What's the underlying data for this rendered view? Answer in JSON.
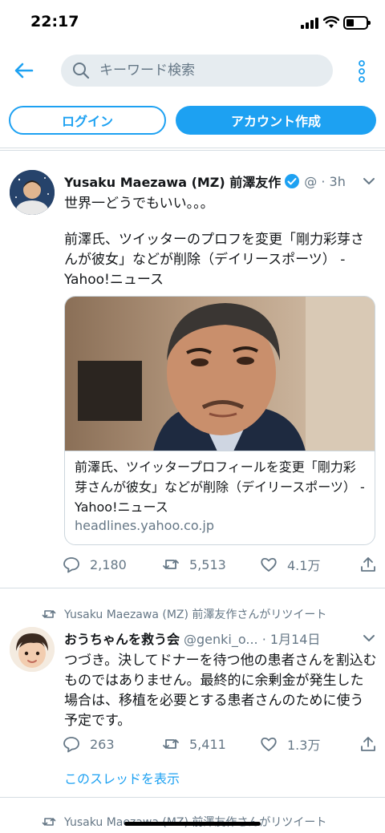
{
  "status_bar": {
    "time": "22:17"
  },
  "nav": {
    "search_placeholder": "キーワード検索",
    "back_icon": "arrow-left-icon",
    "more_icon": "vertical-dots-icon"
  },
  "auth": {
    "login_label": "ログイン",
    "signup_label": "アカウント作成"
  },
  "tweet1": {
    "author_name": "Yusaku Maezawa (MZ) 前澤友作",
    "handle_time": "@ · 3h",
    "text_line1": "世界一どうでもいい。。。",
    "text_line2": "前澤氏、ツイッターのプロフを変更「剛力彩芽さんが彼女」などが削除（デイリースポーツ） - Yahoo!ニュース",
    "card": {
      "title": "前澤氏、ツイッタープロフィールを変更「剛力彩芽さんが彼女」などが削除（デイリースポーツ） - Yahoo!ニュース",
      "domain": "headlines.yahoo.co.jp"
    },
    "replies": "2,180",
    "retweets": "5,513",
    "likes": "4.1万"
  },
  "tweet2": {
    "retweeted_by": "Yusaku Maezawa (MZ) 前澤友作さんがリツイート",
    "author_name": "おうちゃんを救う会",
    "handle_time": "@genki_o... · 1月14日",
    "text": "つづき。決してドナーを待つ他の患者さんを割込むものではありません。最終的に余剰金が発生した場合は、移植を必要とする患者さんのために使う予定です。",
    "replies": "263",
    "retweets": "5,411",
    "likes": "1.3万",
    "show_thread": "このスレッドを表示"
  },
  "tweet3": {
    "retweeted_by": "Yusaku Maezawa (MZ) 前澤友作さんがリツイート"
  },
  "colors": {
    "accent": "#1da1f2",
    "secondary_text": "#657786",
    "search_bg": "#e6ecf0",
    "divider": "#d6dde3"
  }
}
